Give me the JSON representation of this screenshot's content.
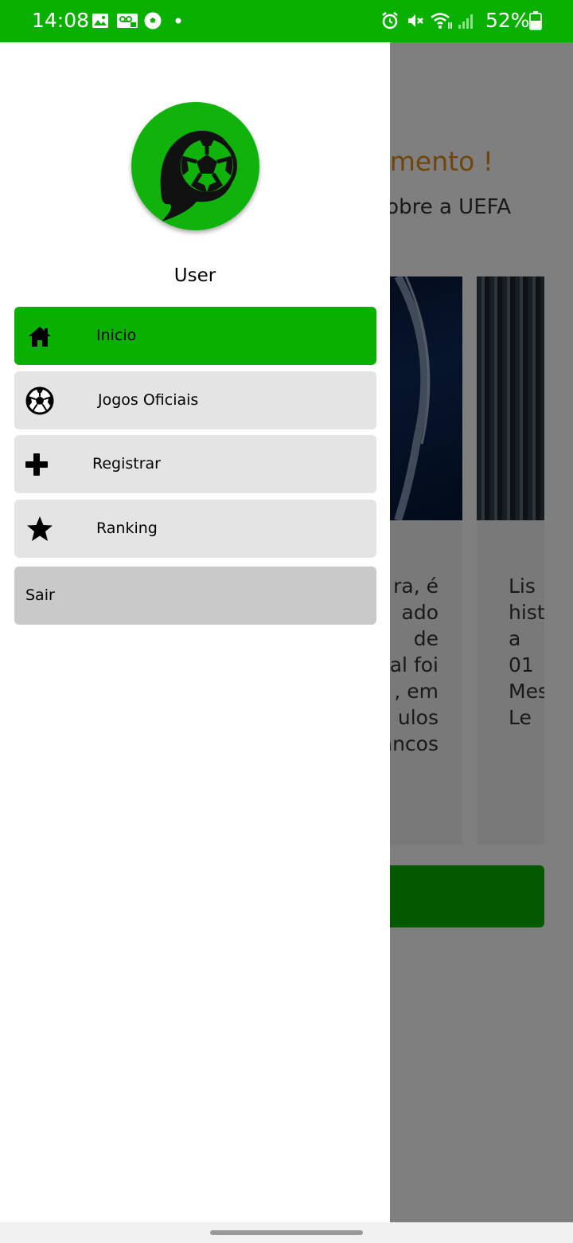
{
  "status_bar": {
    "time": "14:08",
    "battery_percent": "52%",
    "icons": [
      "image-icon",
      "voicemail-icon",
      "soccer-ball-icon",
      "dot-icon",
      "alarm-icon",
      "mute-icon",
      "wifi-icon",
      "signal-icon",
      "battery-icon"
    ]
  },
  "background_screen": {
    "headline": "omento !",
    "subline": "sobre a UEFA",
    "cards": [
      {
        "text_lines": [
          "ra, é",
          "ado",
          "de",
          "nal foi",
          ", em",
          "ulos",
          "ancos"
        ]
      },
      {
        "text_lines": [
          "Lis",
          "hist",
          "a",
          "01",
          "Mes",
          "Le"
        ]
      }
    ]
  },
  "drawer": {
    "logo_icon": "soccer-ball-flame-logo",
    "user_name": "User",
    "menu": [
      {
        "label": "Inicio",
        "icon": "home-icon",
        "active": true
      },
      {
        "label": "Jogos Oficiais",
        "icon": "soccer-ball-icon",
        "active": false
      },
      {
        "label": "Registrar",
        "icon": "plus-icon",
        "active": false
      },
      {
        "label": "Ranking",
        "icon": "star-icon",
        "active": false
      }
    ],
    "logout_label": "Sair"
  },
  "colors": {
    "primary_green": "#09b000",
    "menu_item_bg": "#e4e4e4",
    "logout_bg": "#c9c9c9",
    "headline_orange": "#e08a16"
  }
}
